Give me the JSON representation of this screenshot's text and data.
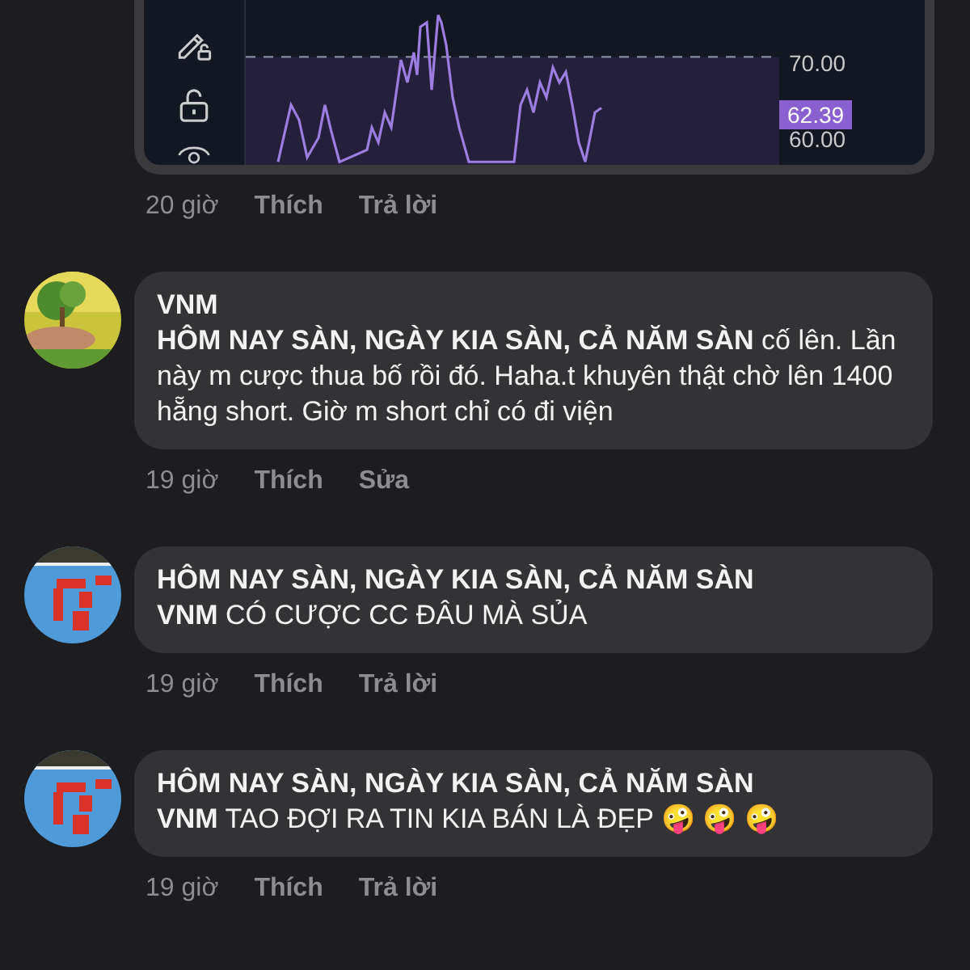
{
  "attachment": {
    "axis_labels": [
      "70.00",
      "60.00"
    ],
    "price_badge": "62.39",
    "time": "20 giờ",
    "actions": [
      "Thích",
      "Trả lời"
    ]
  },
  "comments": [
    {
      "author": "VNM",
      "body": "**HÔM NAY SÀN, NGÀY KIA SÀN, CẢ NĂM SÀN** cố lên. Lần này m cược thua bố rồi đó. Haha.t khuyên thật chờ lên 1400 hẵng short. Giờ m short chỉ có đi viện",
      "time": "19 giờ",
      "actions": [
        "Thích",
        "Sửa"
      ]
    },
    {
      "author": "HÔM NAY SÀN, NGÀY KIA SÀN, CẢ NĂM SÀN",
      "body": "**VNM**  CÓ CƯỢC CC ĐÂU MÀ SỦA",
      "time": "19 giờ",
      "actions": [
        "Thích",
        "Trả lời"
      ]
    },
    {
      "author": "HÔM NAY SÀN, NGÀY KIA SÀN, CẢ NĂM SÀN",
      "body": "**VNM**  TAO ĐỢI RA TIN KIA BÁN LÀ ĐẸP 🤪 🤪 🤪",
      "time": "19 giờ",
      "actions": [
        "Thích",
        "Trả lời"
      ]
    }
  ]
}
